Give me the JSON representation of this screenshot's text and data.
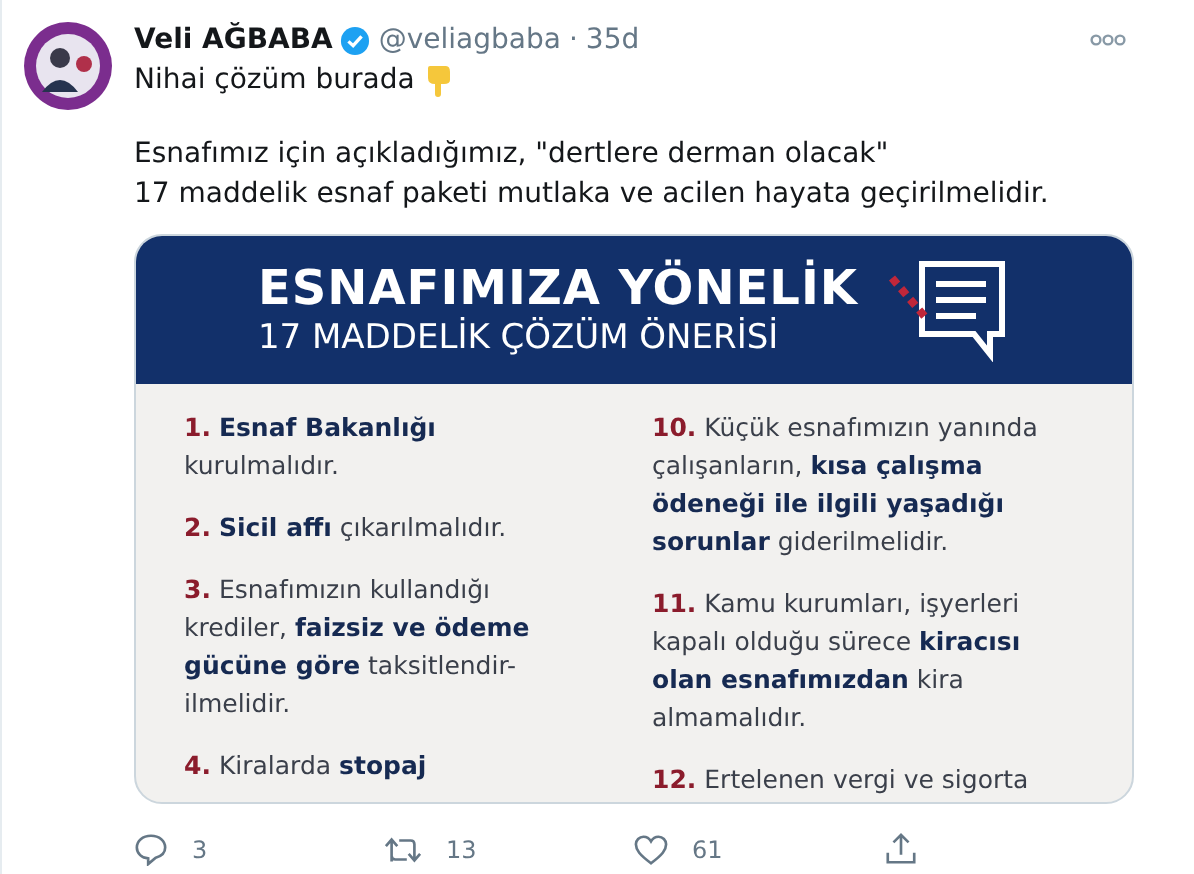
{
  "tweet": {
    "name": "Veli AĞBABA",
    "verified": true,
    "handle": "@veliagbaba",
    "separator": "·",
    "time": "35d",
    "text_lines": [
      "Nihai çözüm burada"
    ],
    "body_lines": [
      "Esnafımız için açıkladığımız, \"dertlere derman olacak\"",
      "17 maddelik esnaf paketi mutlaka ve acilen hayata geçirilmelidir."
    ]
  },
  "infographic": {
    "title": "ESNAFIMIZA YÖNELİK",
    "subtitle": "17 MADDELİK ÇÖZÜM ÖNERİSİ",
    "columns": [
      [
        {
          "number": "1.",
          "text": "**Esnaf Bakanlığı** kurulmalıdır."
        },
        {
          "number": "2.",
          "text": "**Sicil affı** çıkarılmalıdır."
        },
        {
          "number": "3.",
          "text": "Esnafımızın kullandığı krediler, **faizsiz ve ödeme gücüne göre** taksitlendir-ilmelidir."
        },
        {
          "number": "4.",
          "text": "Kiralarda **stopaj**"
        }
      ],
      [
        {
          "number": "10.",
          "text": "Küçük esnafımızın yanında çalışanların, **kısa çalışma ödeneği ile ilgili yaşadığı sorunlar** giderilmelidir."
        },
        {
          "number": "11.",
          "text": "Kamu kurumları, işyerleri kapalı olduğu sürece **kiracısı olan esnafımızdan** kira almamalıdır."
        },
        {
          "number": "12.",
          "text": "Ertelenen vergi ve sigorta"
        }
      ]
    ]
  },
  "actions": {
    "replies": "3",
    "retweets": "13",
    "likes": "61"
  }
}
